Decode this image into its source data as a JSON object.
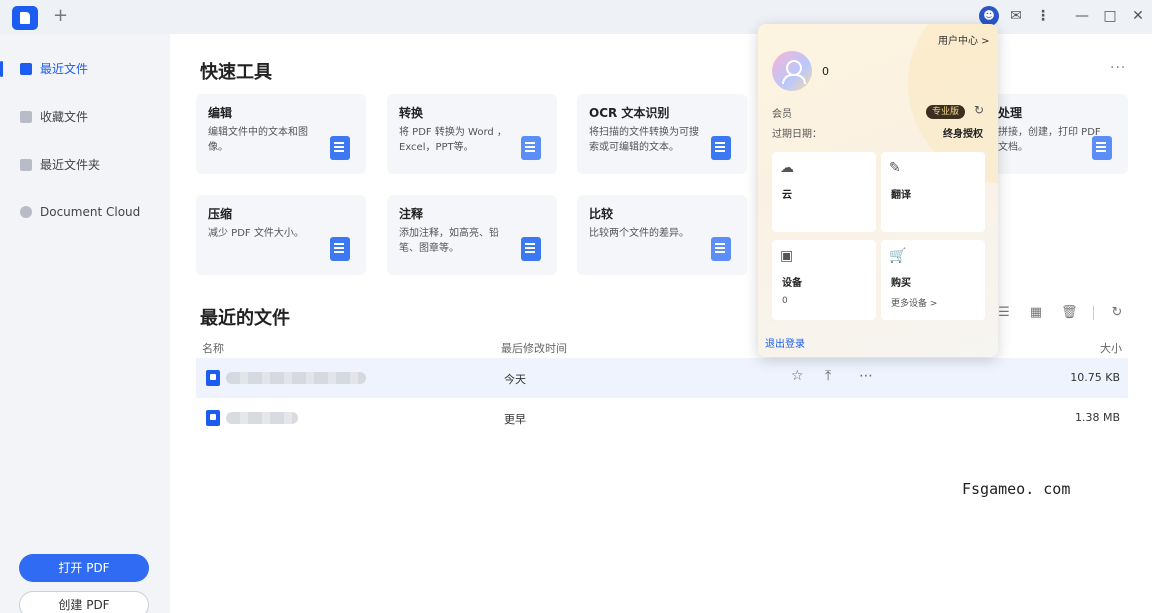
{
  "titlebar": {
    "new_tab": "+",
    "icons": [
      "user-icon",
      "message-icon",
      "more-icon",
      "minimize-icon",
      "maximize-icon",
      "close-icon"
    ]
  },
  "sidebar": {
    "items": [
      {
        "label": "最近文件",
        "icon": "recent-icon",
        "active": true
      },
      {
        "label": "收藏文件",
        "icon": "star-icon",
        "active": false
      },
      {
        "label": "最近文件夹",
        "icon": "folder-icon",
        "active": false
      },
      {
        "label": "Document Cloud",
        "icon": "cloud-icon",
        "active": false
      }
    ],
    "open_pdf": "打开 PDF",
    "create_pdf": "创建 PDF"
  },
  "main": {
    "quick_tools_title": "快速工具",
    "more": "···",
    "tools": [
      {
        "name": "编辑",
        "desc": "编辑文件中的文本和图像。"
      },
      {
        "name": "转换",
        "desc": "将 PDF 转换为 Word ，Excel，PPT等。"
      },
      {
        "name": "OCR 文本识别",
        "desc": "将扫描的文件转换为可搜索或可编辑的文本。"
      },
      {
        "name": "处理",
        "desc": "拼接，创建，打印 PDF 文档。"
      },
      {
        "name": "压缩",
        "desc": "减少 PDF 文件大小。"
      },
      {
        "name": "注释",
        "desc": "添加注释，如高亮、铅笔、图章等。"
      },
      {
        "name": "比较",
        "desc": "比较两个文件的差异。"
      }
    ],
    "recent_title": "最近的文件",
    "columns": {
      "name": "名称",
      "modified": "最后修改时间",
      "size": "大小"
    },
    "files": [
      {
        "date": "今天",
        "size": "10.75 KB"
      },
      {
        "date": "更早",
        "size": "1.38 MB"
      }
    ]
  },
  "popup": {
    "user_center": "用户中心 >",
    "username": "0",
    "member_label": "会员",
    "badge": "专业版",
    "expiry_label": "过期日期：",
    "expiry_value": "终身授权",
    "cards": [
      {
        "title": "云",
        "sub": "",
        "icon": "cloud-upload-icon"
      },
      {
        "title": "翻译",
        "sub": "",
        "icon": "translate-icon"
      },
      {
        "title": "设备",
        "sub": "0",
        "icon": "device-icon"
      },
      {
        "title": "购买",
        "sub": "更多设备 >",
        "icon": "cart-icon"
      }
    ],
    "logout": "退出登录"
  },
  "watermark": "Fsgameo. com",
  "colors": {
    "accent": "#1d5cf0",
    "badge_bg": "#3b2f20",
    "badge_fg": "#f7d58c"
  }
}
